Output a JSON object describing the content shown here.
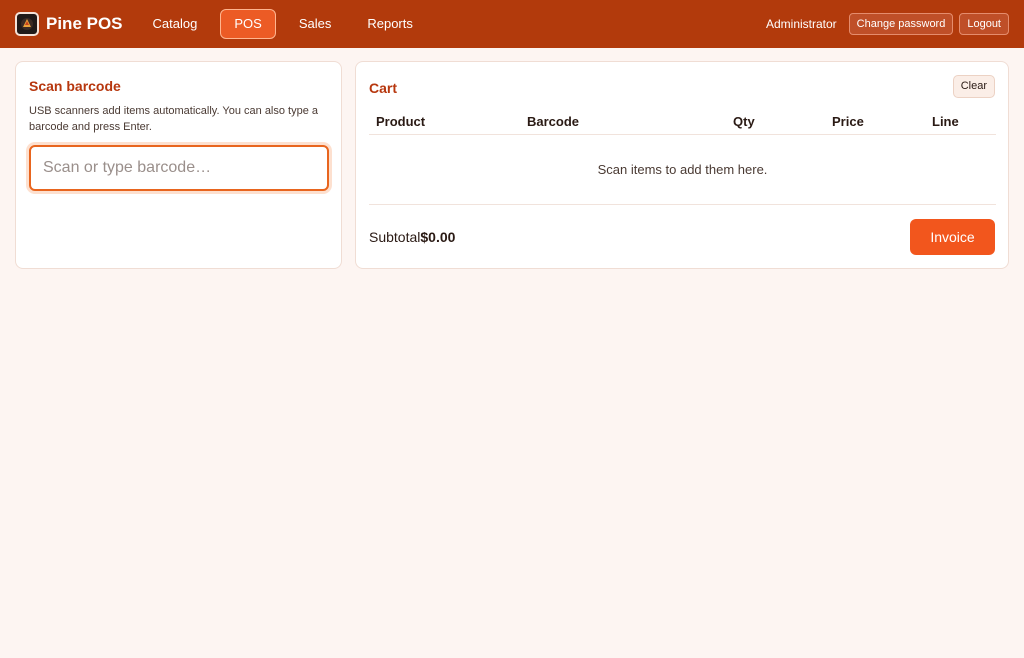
{
  "brand": {
    "name": "Pine POS",
    "logo_icon": "pine-pos-logo-icon"
  },
  "nav": {
    "items": [
      {
        "label": "Catalog",
        "active": false
      },
      {
        "label": "POS",
        "active": true
      },
      {
        "label": "Sales",
        "active": false
      },
      {
        "label": "Reports",
        "active": false
      }
    ]
  },
  "user": {
    "name": "Administrator",
    "change_password_label": "Change password",
    "logout_label": "Logout"
  },
  "scan": {
    "title": "Scan barcode",
    "help": "USB scanners add items automatically. You can also type a barcode and press Enter.",
    "input_value": "",
    "placeholder": "Scan or type barcode…"
  },
  "cart": {
    "title": "Cart",
    "clear_label": "Clear",
    "columns": [
      "Product",
      "Barcode",
      "Qty",
      "Price",
      "Line"
    ],
    "empty_message": "Scan items to add them here.",
    "subtotal_label": "Subtotal",
    "subtotal_value": "$0.00",
    "invoice_label": "Invoice"
  },
  "colors": {
    "header_bg": "#b23a0c",
    "accent": "#f2561d",
    "title": "#b7370e",
    "page_bg": "#fdf5f2"
  }
}
